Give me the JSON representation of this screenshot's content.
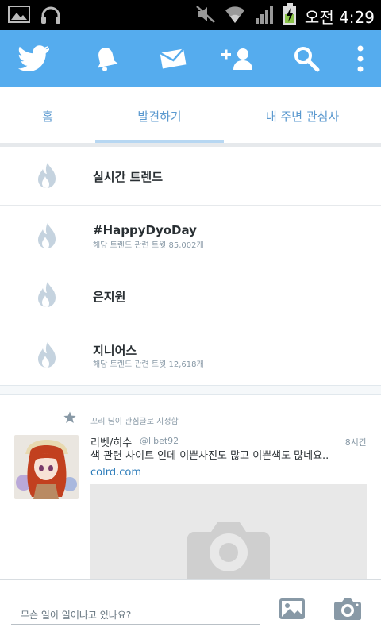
{
  "status_bar": {
    "time": "오전 4:29",
    "icons": [
      "gallery-icon",
      "headset-icon",
      "mute-icon",
      "wifi-icon",
      "signal-icon",
      "battery-charging-icon"
    ]
  },
  "action_bar": {
    "icons": [
      "twitter-bird-icon",
      "notifications-bell-icon",
      "messages-envelope-icon",
      "add-user-icon",
      "search-icon",
      "overflow-menu-icon"
    ],
    "background": "#55acee"
  },
  "tabs": [
    {
      "label": "홈",
      "selected": false
    },
    {
      "label": "발견하기",
      "selected": true
    },
    {
      "label": "내 주변 관심사",
      "selected": false
    }
  ],
  "trends": {
    "header": "실시간 트렌드",
    "items": [
      {
        "title": "#HappyDyoDay",
        "subtitle": "해당 트렌드 관련 트윗 85,002개"
      },
      {
        "title": "은지원",
        "subtitle": ""
      },
      {
        "title": "지니어스",
        "subtitle": "해당 트렌드 관련 트윗 12,618개"
      }
    ]
  },
  "tweet": {
    "context": "꼬리 님이 관심글로 지정함",
    "name": "리벳/히수",
    "handle": "@libet92",
    "time": "8시간",
    "text": "색 관련 사이트 인데 이쁜사진도 많고 이쁜색도 많네요.. ",
    "link": "colrd.com"
  },
  "compose": {
    "placeholder": "무슨 일이 일어나고 있나요?"
  }
}
